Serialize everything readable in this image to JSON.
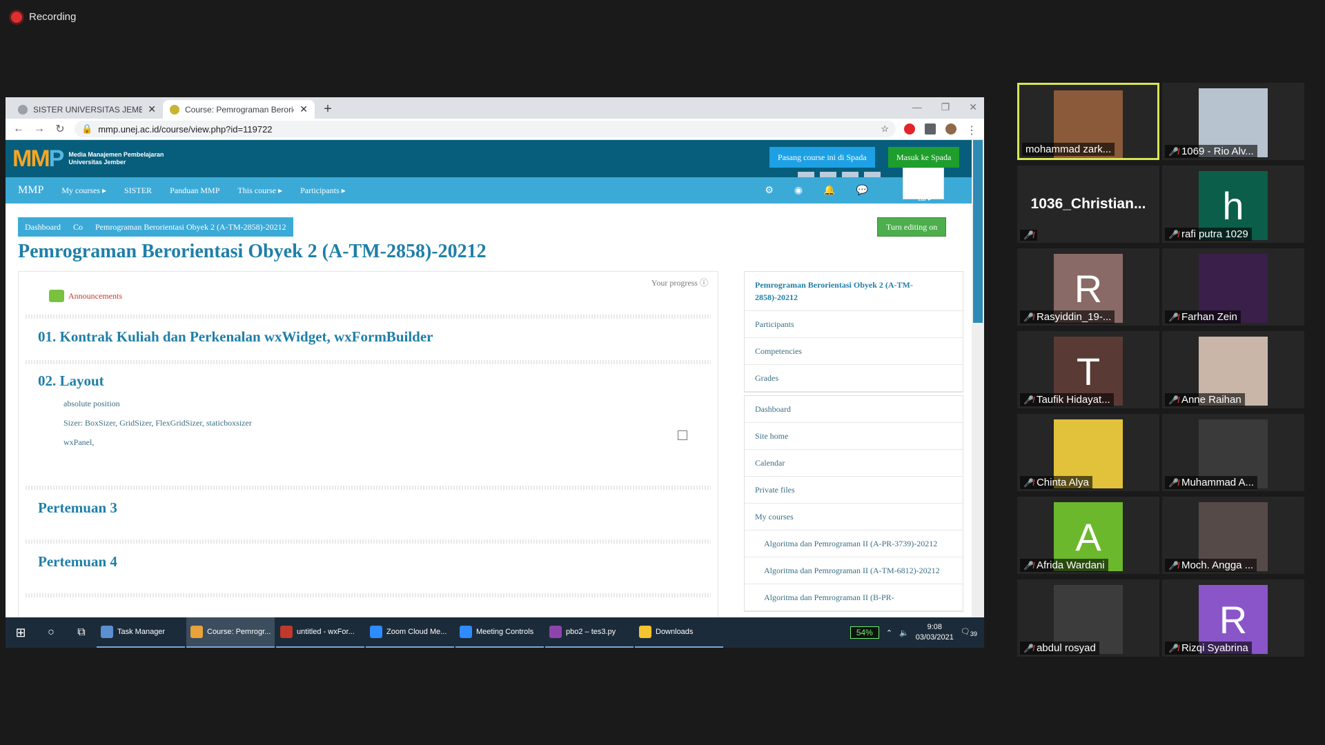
{
  "recording": {
    "label": "Recording"
  },
  "browser": {
    "tabs": [
      {
        "title": "SISTER UNIVERSITAS JEMBER",
        "close": "✕"
      },
      {
        "title": "Course: Pemrograman Berorientasi",
        "close": "✕"
      }
    ],
    "new_tab": "+",
    "url": "mmp.unej.ac.id/course/view.php?id=119722"
  },
  "moodle": {
    "logo_text": "MMP",
    "logo_sub_1": "Media Manajemen Pembelajaran",
    "logo_sub_2": "Universitas Jember",
    "btn_pasang": "Pasang course ini di Spada",
    "btn_masuk": "Masuk ke Spada",
    "menu": {
      "brand": "MMP",
      "items": [
        "My courses ▸",
        "SISTER",
        "Panduan MMP",
        "This course ▸",
        "Participants ▸"
      ]
    },
    "user_short": "zar ▸",
    "breadcrumb": [
      "Dashboard",
      "Co",
      "Pemrograman Berorientasi Obyek 2 (A-TM-2858)-20212"
    ],
    "turn_editing": "Turn editing on",
    "page_title": "Pemrograman Berorientasi Obyek 2 (A-TM-2858)-20212",
    "your_progress": "Your progress",
    "announcements": "Announcements",
    "sections": [
      "01. Kontrak Kuliah dan Perkenalan wxWidget, wxFormBuilder",
      "02. Layout",
      "Pertemuan 3",
      "Pertemuan 4"
    ],
    "layout_items": [
      "absolute position",
      "Sizer: BoxSizer, GridSizer, FlexGridSizer, staticboxsizer",
      "wxPanel,"
    ],
    "side_course": [
      "Pemrograman Berorientasi Obyek 2 (A-TM-2858)-20212",
      "Participants",
      "Competencies",
      "Grades"
    ],
    "side_nav": [
      "Dashboard",
      "Site home",
      "Calendar",
      "Private files",
      "My courses"
    ],
    "side_courses": [
      "Algoritma dan Pemrograman II (A-PR-3739)-20212",
      "Algoritma dan Pemrograman II (A-TM-6812)-20212",
      "Algoritma dan Pemrograman II (B-PR-"
    ]
  },
  "taskbar": {
    "items": [
      {
        "label": "Task Manager",
        "color": "#5a8fd0"
      },
      {
        "label": "Course: Pemrogr...",
        "color": "#e8a33a"
      },
      {
        "label": "untitled - wxFor...",
        "color": "#c0392b"
      },
      {
        "label": "Zoom Cloud Me...",
        "color": "#2d8cff"
      },
      {
        "label": "Meeting Controls",
        "color": "#2d8cff"
      },
      {
        "label": "pbo2 – tes3.py",
        "color": "#8e44ad"
      },
      {
        "label": "Downloads",
        "color": "#f4c430"
      }
    ],
    "battery": "54%",
    "time": "9:08",
    "date": "03/03/2021",
    "notif_count": "39"
  },
  "participants": [
    {
      "name": "mohammad zark...",
      "initial": "",
      "bg": "#8a5a3a",
      "speaking": true,
      "muted": false
    },
    {
      "name": "1069 - Rio Alv...",
      "initial": "",
      "bg": "#b7c3cf",
      "speaking": false,
      "muted": true
    },
    {
      "name": "",
      "big": "1036_Christian...",
      "initial": "",
      "bg": "",
      "speaking": false,
      "muted": true
    },
    {
      "name": "rafi putra 1029",
      "initial": "h",
      "bg": "#0b5e4a",
      "speaking": false,
      "muted": true
    },
    {
      "name": "Rasyiddin_19-...",
      "initial": "R",
      "bg": "#8a6a66",
      "speaking": false,
      "muted": true
    },
    {
      "name": "Farhan Zein",
      "initial": "",
      "bg": "#3a1f4a",
      "speaking": false,
      "muted": true
    },
    {
      "name": "Taufik Hidayat...",
      "initial": "T",
      "bg": "#5a3a35",
      "speaking": false,
      "muted": true
    },
    {
      "name": "Anne Raihan",
      "initial": "",
      "bg": "#c9b6a8",
      "speaking": false,
      "muted": true
    },
    {
      "name": "Chinta Alya",
      "initial": "",
      "bg": "#e2c23a",
      "speaking": false,
      "muted": true
    },
    {
      "name": "Muhammad A...",
      "initial": "",
      "bg": "#3a3a3a",
      "speaking": false,
      "muted": true
    },
    {
      "name": "Afrida Wardani",
      "initial": "A",
      "bg": "#6cb82c",
      "speaking": false,
      "muted": true
    },
    {
      "name": "Moch. Angga ...",
      "initial": "",
      "bg": "#554a48",
      "speaking": false,
      "muted": true
    },
    {
      "name": "abdul rosyad",
      "initial": "",
      "bg": "#3c3c3c",
      "speaking": false,
      "muted": true
    },
    {
      "name": "Rizqi Syabrina",
      "initial": "R",
      "bg": "#8a55c8",
      "speaking": false,
      "muted": true
    }
  ]
}
